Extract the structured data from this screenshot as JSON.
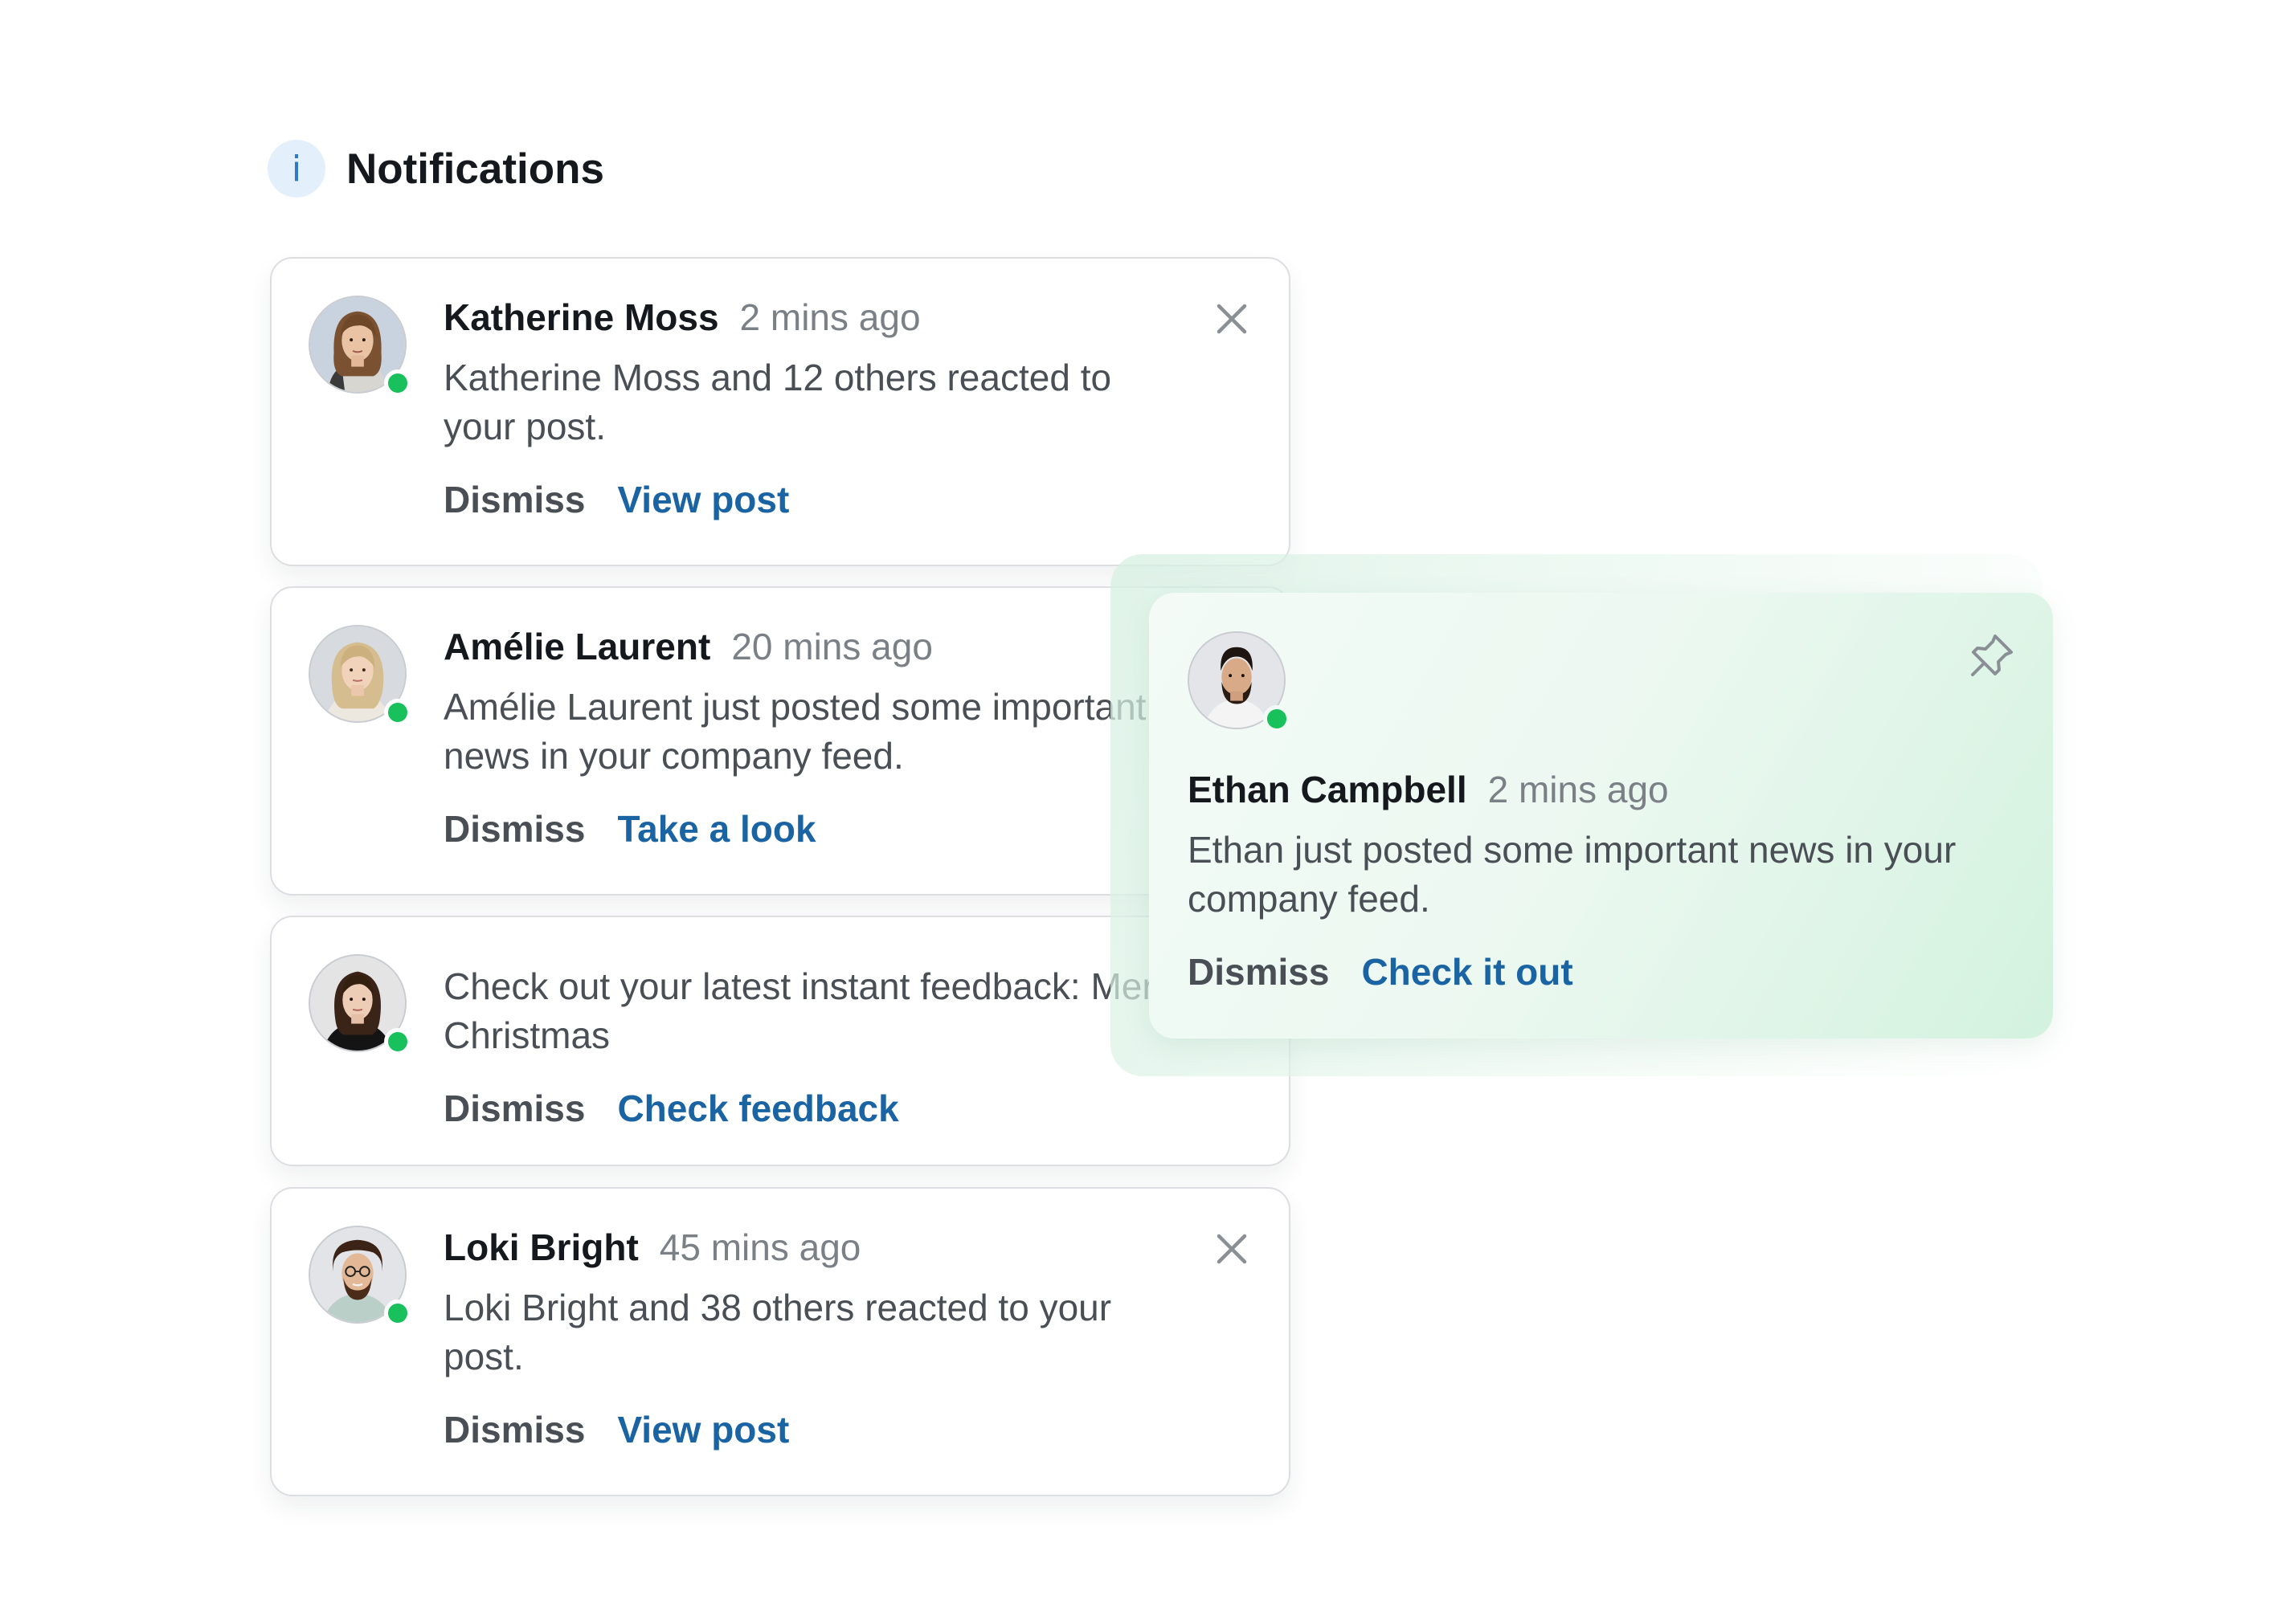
{
  "header": {
    "icon": "info-icon",
    "icon_glyph": "i",
    "title": "Notifications"
  },
  "colors": {
    "accent_link": "#1a64a4",
    "online": "#18c15b",
    "toast_gradient_start": "#f4fbf7",
    "toast_gradient_end": "#d3f2df"
  },
  "notifications": [
    {
      "avatar": "avatar-katherine",
      "name": "Katherine Moss",
      "time": "2 mins ago",
      "message": "Katherine Moss and 12 others reacted to your post.",
      "dismiss_label": "Dismiss",
      "action_label": "View post",
      "close_icon": "close-icon"
    },
    {
      "avatar": "avatar-amelie",
      "name": "Amélie Laurent",
      "time": "20 mins ago",
      "message_line1": "Amélie Laurent just posted some important",
      "message_line2": "news in your company feed.",
      "dismiss_label": "Dismiss",
      "action_label": "Take a look"
    },
    {
      "avatar": "avatar-feedback",
      "message": "Check out your latest instant feedback: Merry Christmas",
      "dismiss_label": "Dismiss",
      "action_label": "Check feedback"
    },
    {
      "avatar": "avatar-loki",
      "name": "Loki Bright",
      "time": "45 mins ago",
      "message": "Loki Bright and 38 others reacted to your post.",
      "dismiss_label": "Dismiss",
      "action_label": "View post",
      "close_icon": "close-icon"
    }
  ],
  "toast": {
    "avatar": "avatar-ethan",
    "name": "Ethan Campbell",
    "time": "2 mins ago",
    "message": "Ethan just posted some important news in your company feed.",
    "dismiss_label": "Dismiss",
    "action_label": "Check it out",
    "pin_icon": "pin-icon"
  }
}
